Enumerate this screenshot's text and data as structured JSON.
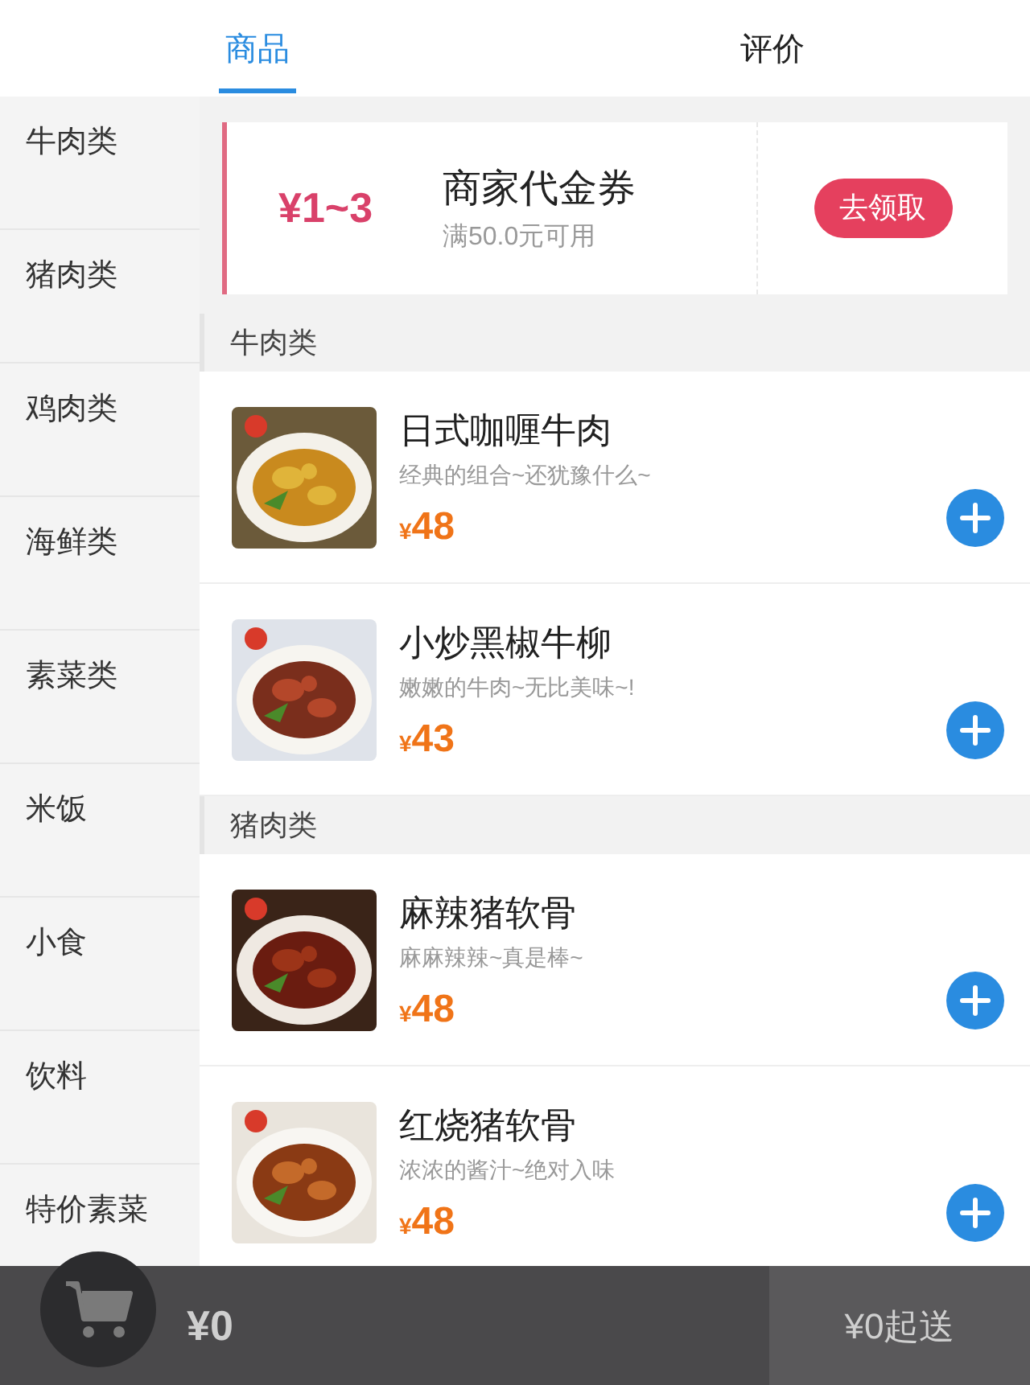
{
  "tabs": [
    {
      "label": "商品",
      "selected": true
    },
    {
      "label": "评价",
      "selected": false
    }
  ],
  "sidebar": {
    "items": [
      "牛肉类",
      "猪肉类",
      "鸡肉类",
      "海鲜类",
      "素菜类",
      "米饭",
      "小食",
      "饮料",
      "特价素菜"
    ]
  },
  "coupon": {
    "amount": "¥1~3",
    "title": "商家代金券",
    "condition": "满50.0元可用",
    "button": "去领取"
  },
  "sections": [
    {
      "title": "牛肉类",
      "items": [
        {
          "name": "日式咖喱牛肉",
          "desc": "经典的组合~还犹豫什么~",
          "currency": "¥",
          "price": "48"
        },
        {
          "name": "小炒黑椒牛柳",
          "desc": "嫩嫩的牛肉~无比美味~!",
          "currency": "¥",
          "price": "43"
        }
      ]
    },
    {
      "title": "猪肉类",
      "items": [
        {
          "name": "麻辣猪软骨",
          "desc": "麻麻辣辣~真是棒~",
          "currency": "¥",
          "price": "48"
        },
        {
          "name": "红烧猪软骨",
          "desc": "浓浓的酱汁~绝对入味",
          "currency": "¥",
          "price": "48"
        }
      ]
    }
  ],
  "cart": {
    "total": "¥0",
    "min_order": "¥0起送"
  }
}
